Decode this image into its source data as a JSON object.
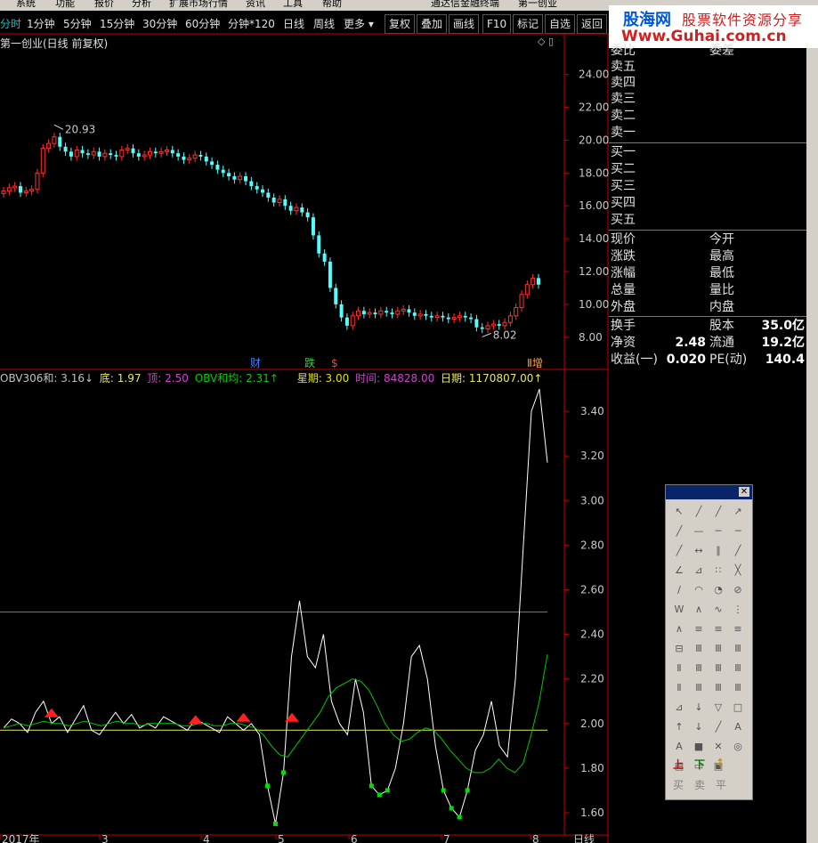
{
  "menu": [
    "系统",
    "功能",
    "报价",
    "分析",
    "扩展市场行情",
    "资讯",
    "工具",
    "帮助",
    "通达信金融终端",
    "第一创业"
  ],
  "toolbar": {
    "periods": [
      "分时",
      "1分钟",
      "5分钟",
      "15分钟",
      "30分钟",
      "60分钟",
      "分钟*120",
      "日线",
      "周线",
      "更多 ▾"
    ],
    "buttons": [
      "复权",
      "叠加",
      "画线",
      "F10",
      "标记",
      "自选",
      "返回"
    ]
  },
  "banner": {
    "line1a": "股海网",
    "line1b": "股票软件资源分享",
    "line2": "Www.Guhai.com.cn"
  },
  "chart_title": "第一创业(日线 前复权)",
  "price_axis": [
    "24.00",
    "22.00",
    "20.00",
    "18.00",
    "16.00",
    "14.00",
    "12.00",
    "10.00",
    "8.00"
  ],
  "price_annotations": {
    "high": "20.93",
    "low": "8.02"
  },
  "event_markers": [
    "财",
    "跌",
    "$",
    "Ⅱ增"
  ],
  "indicator": {
    "name": "OBV306和",
    "prefix": "OBV306和: 3.16↓",
    "di": "底: 1.97",
    "ding": "顶: 2.50",
    "junxian": "OBV和均: 2.31↑",
    "xingqi": "星期: 3.00",
    "shijian": "时间: 84828.00",
    "riqi": "日期: 1170807.00↑"
  },
  "indicator_axis": [
    "3.40",
    "3.20",
    "3.00",
    "2.80",
    "2.60",
    "2.40",
    "2.20",
    "2.00",
    "1.80",
    "1.60"
  ],
  "date_axis": [
    "2017年",
    "3",
    "4",
    "5",
    "6",
    "7",
    "8"
  ],
  "date_axis_label": "日线",
  "quote": {
    "title_left": "委比",
    "title_right": "委差",
    "sell": [
      "卖五",
      "卖四",
      "卖三",
      "卖二",
      "卖一"
    ],
    "buy": [
      "买一",
      "买二",
      "买三",
      "买四",
      "买五"
    ],
    "left_col": [
      "现价",
      "涨跌",
      "涨幅",
      "总量",
      "外盘"
    ],
    "right_col": [
      "今开",
      "最高",
      "最低",
      "量比",
      "内盘"
    ],
    "stats": [
      {
        "label": "换手",
        "value": "",
        "label2": "股本",
        "value2": "35.0亿"
      },
      {
        "label": "净资",
        "value": "2.48",
        "label2": "流通",
        "value2": "19.2亿"
      },
      {
        "label": "收益(一)",
        "value": "0.020",
        "label2": "PE(动)",
        "value2": "140.4"
      }
    ]
  },
  "palette": {
    "bottom_labels": [
      "上",
      "下",
      "↕"
    ],
    "footer": [
      "买",
      "卖",
      "平"
    ]
  },
  "colors": {
    "up": "#ff3232",
    "down": "#54fcfc",
    "obv": "#ffffff",
    "obv_avg": "#00c800",
    "ding_line": "#c040c0",
    "di_line": "#e8e860"
  },
  "chart_data": [
    {
      "type": "candlestick",
      "ylim": [
        7.5,
        25.5
      ],
      "annotations": [
        {
          "label": "20.93",
          "y": 20.93
        },
        {
          "label": "8.02",
          "y": 8.02
        }
      ],
      "close": [
        16.9,
        17.1,
        17.2,
        16.8,
        16.9,
        17.0,
        18.0,
        19.5,
        19.8,
        20.2,
        19.6,
        19.3,
        19.0,
        19.4,
        19.2,
        19.1,
        19.3,
        19.0,
        19.2,
        19.1,
        19.0,
        19.4,
        19.5,
        19.2,
        19.0,
        19.1,
        19.3,
        19.2,
        19.3,
        19.4,
        19.2,
        19.0,
        18.8,
        18.9,
        19.1,
        19.0,
        18.7,
        18.5,
        18.2,
        18.0,
        17.8,
        17.6,
        17.8,
        17.5,
        17.2,
        17.0,
        16.8,
        16.5,
        16.2,
        16.4,
        16.0,
        15.7,
        15.9,
        15.6,
        15.3,
        14.2,
        13.1,
        12.6,
        11.0,
        10.0,
        9.2,
        8.7,
        9.3,
        9.6,
        9.4,
        9.5,
        9.4,
        9.6,
        9.5,
        9.4,
        9.6,
        9.7,
        9.5,
        9.3,
        9.4,
        9.3,
        9.2,
        9.3,
        9.2,
        9.1,
        9.2,
        9.3,
        9.2,
        9.1,
        8.6,
        8.5,
        8.7,
        8.8,
        8.7,
        8.9,
        9.3,
        9.8,
        10.6,
        11.2,
        11.6,
        11.2
      ]
    },
    {
      "type": "line",
      "ylim": [
        1.5,
        3.52
      ],
      "series": [
        {
          "name": "OBV306和",
          "values": [
            1.98,
            2.02,
            2.0,
            1.96,
            2.05,
            2.1,
            2.0,
            2.03,
            1.96,
            2.02,
            2.08,
            1.97,
            1.95,
            2.0,
            2.05,
            2.0,
            2.04,
            1.98,
            2.0,
            1.98,
            2.03,
            2.01,
            1.99,
            1.97,
            2.02,
            2.0,
            1.98,
            1.96,
            2.03,
            2.0,
            1.97,
            2.0,
            1.95,
            1.72,
            1.55,
            1.78,
            2.3,
            2.55,
            2.3,
            2.25,
            2.4,
            2.1,
            2.0,
            1.95,
            2.2,
            2.05,
            1.72,
            1.68,
            1.7,
            1.8,
            2.0,
            2.3,
            2.35,
            2.2,
            1.9,
            1.7,
            1.62,
            1.58,
            1.7,
            1.88,
            1.95,
            2.1,
            1.9,
            1.85,
            2.2,
            2.8,
            3.4,
            3.5,
            3.17
          ]
        },
        {
          "name": "OBV和均",
          "values": [
            1.98,
            1.99,
            2.0,
            1.99,
            2.0,
            2.01,
            2.0,
            2.0,
            1.99,
            2.0,
            2.01,
            2.0,
            1.99,
            2.0,
            2.01,
            2.0,
            2.0,
            1.99,
            2.0,
            2.0,
            2.0,
            2.0,
            1.99,
            1.99,
            2.0,
            2.0,
            1.99,
            1.99,
            2.0,
            2.0,
            1.99,
            1.98,
            1.95,
            1.9,
            1.86,
            1.85,
            1.9,
            1.95,
            2.0,
            2.05,
            2.12,
            2.16,
            2.18,
            2.2,
            2.19,
            2.15,
            2.08,
            2.0,
            1.95,
            1.92,
            1.93,
            1.96,
            1.98,
            1.97,
            1.93,
            1.88,
            1.84,
            1.8,
            1.78,
            1.78,
            1.8,
            1.84,
            1.8,
            1.78,
            1.82,
            1.95,
            2.1,
            2.31
          ]
        }
      ],
      "reference_lines": [
        {
          "name": "顶",
          "y": 2.5
        },
        {
          "name": "底",
          "y": 1.97
        }
      ]
    }
  ]
}
